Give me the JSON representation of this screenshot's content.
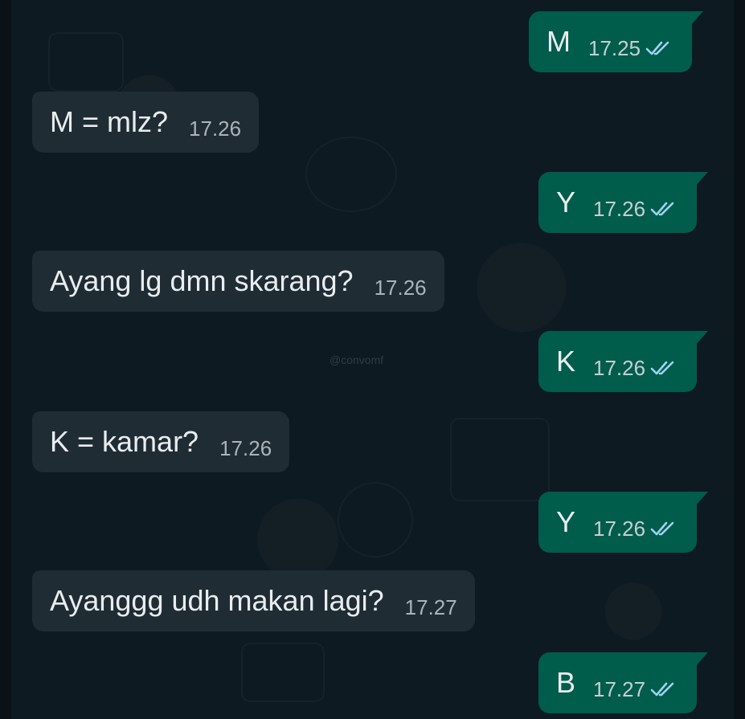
{
  "chat": {
    "watermark": "@convomf",
    "messages": [
      {
        "text": "M",
        "time": "17.25",
        "direction": "outgoing",
        "read_receipt": "double-check-icon"
      },
      {
        "text": "M = mlz?",
        "time": "17.26",
        "direction": "incoming"
      },
      {
        "text": "Y",
        "time": "17.26",
        "direction": "outgoing",
        "read_receipt": "double-check-icon"
      },
      {
        "text": "Ayang lg dmn skarang?",
        "time": "17.26",
        "direction": "incoming"
      },
      {
        "text": "K",
        "time": "17.26",
        "direction": "outgoing",
        "read_receipt": "double-check-icon"
      },
      {
        "text": "K = kamar?",
        "time": "17.26",
        "direction": "incoming"
      },
      {
        "text": "Y",
        "time": "17.26",
        "direction": "outgoing",
        "read_receipt": "double-check-icon"
      },
      {
        "text": "Ayanggg udh makan lagi?",
        "time": "17.27",
        "direction": "incoming"
      },
      {
        "text": "B",
        "time": "17.27",
        "direction": "outgoing",
        "read_receipt": "double-check-icon"
      }
    ]
  },
  "colors": {
    "background": "#0b141a",
    "incoming_bubble": "#1f2c34",
    "outgoing_bubble": "#005c4b",
    "text": "#e9edef",
    "read_tick": "#9fd3f0"
  }
}
